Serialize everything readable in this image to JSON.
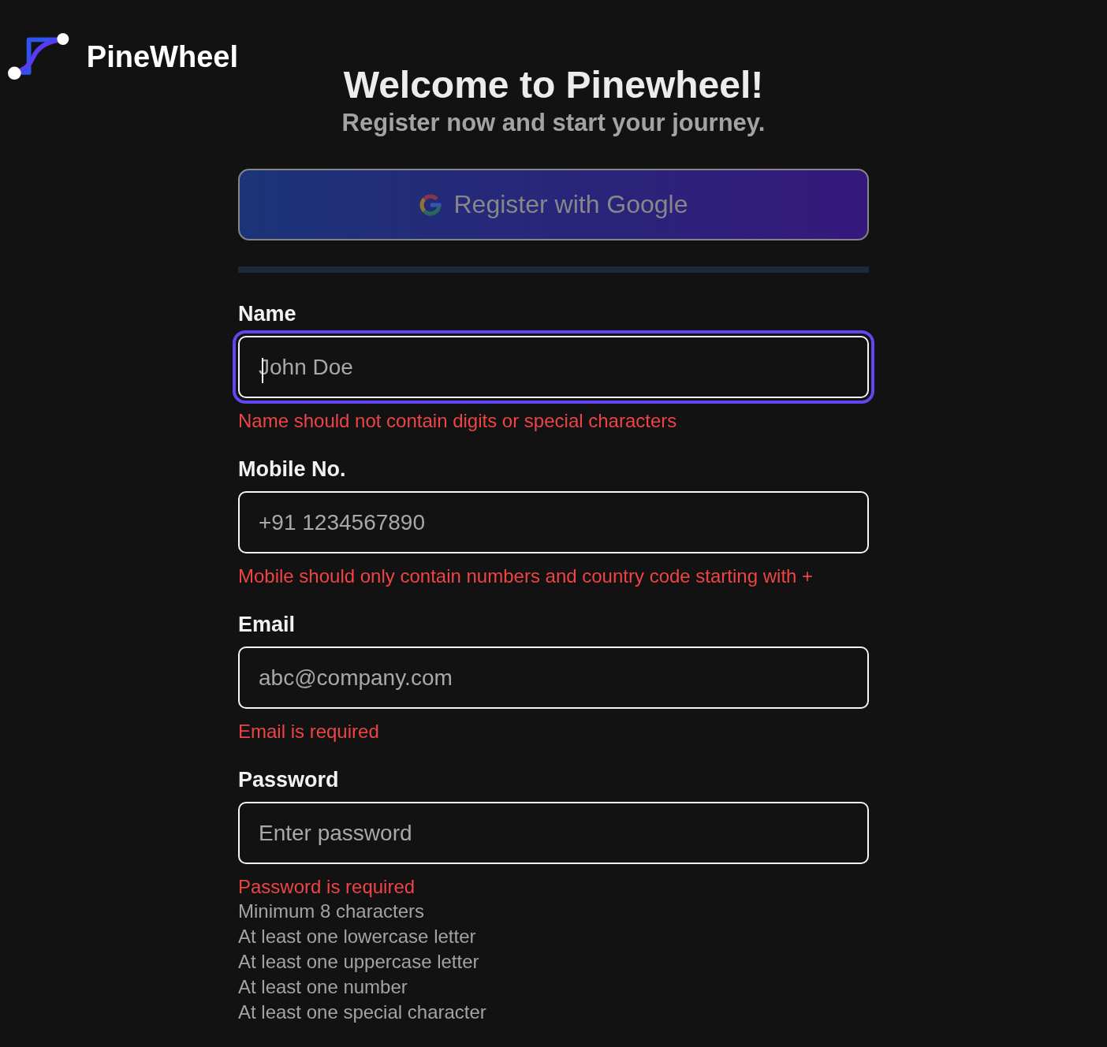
{
  "brand": {
    "name": "PineWheel"
  },
  "heading": {
    "title": "Welcome to Pinewheel!",
    "subtitle": "Register now and start your journey."
  },
  "google_button": {
    "label": "Register with Google",
    "disabled": true
  },
  "fields": [
    {
      "label": "Name",
      "placeholder": "John Doe",
      "focused": true,
      "error": "Name should not contain digits or special characters"
    },
    {
      "label": "Mobile No.",
      "placeholder": "+91 1234567890",
      "focused": false,
      "error": "Mobile should only contain numbers and country code starting with +"
    },
    {
      "label": "Email",
      "placeholder": "abc@company.com",
      "focused": false,
      "error": "Email is required"
    },
    {
      "label": "Password",
      "placeholder": "Enter password",
      "focused": false,
      "error": "Password is required"
    }
  ],
  "password_rules": [
    "Minimum 8 characters",
    "At least one lowercase letter",
    "At least one uppercase letter",
    "At least one number",
    "At least one special character"
  ]
}
